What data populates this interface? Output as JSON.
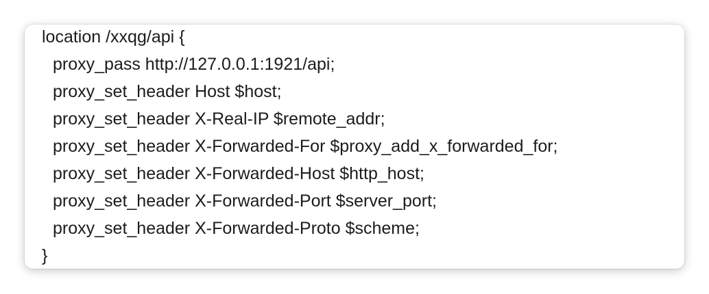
{
  "code_block": {
    "lines": [
      "location /xxqg/api {",
      "proxy_pass http://127.0.0.1:1921/api;",
      "proxy_set_header Host $host;",
      "proxy_set_header X-Real-IP $remote_addr;",
      "proxy_set_header X-Forwarded-For $proxy_add_x_forwarded_for;",
      "proxy_set_header X-Forwarded-Host $http_host;",
      "proxy_set_header X-Forwarded-Port $server_port;",
      "proxy_set_header X-Forwarded-Proto $scheme;",
      "}"
    ]
  }
}
